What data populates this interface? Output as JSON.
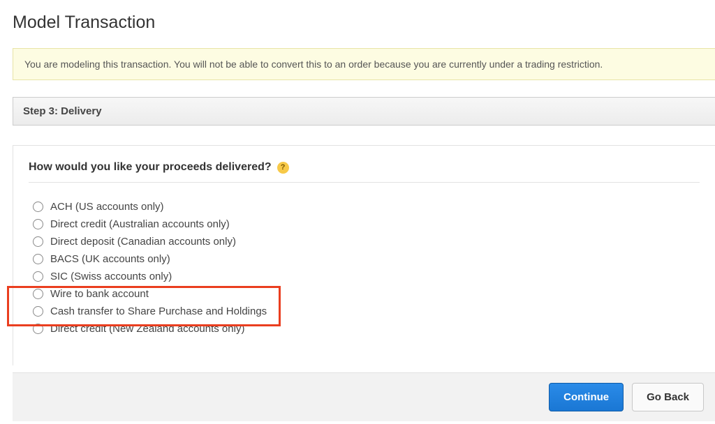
{
  "page": {
    "title": "Model Transaction"
  },
  "notice": {
    "text": "You are modeling this transaction. You will not be able to convert this to an order because you are currently under a trading restriction."
  },
  "step": {
    "label": "Step 3: Delivery"
  },
  "question": {
    "text": "How would you like your proceeds delivered?",
    "help": "?"
  },
  "options": [
    {
      "label": "ACH (US accounts only)"
    },
    {
      "label": "Direct credit (Australian accounts only)"
    },
    {
      "label": "Direct deposit (Canadian accounts only)"
    },
    {
      "label": "BACS (UK accounts only)"
    },
    {
      "label": "SIC (Swiss accounts only)"
    },
    {
      "label": "Wire to bank account"
    },
    {
      "label": "Cash transfer to Share Purchase and Holdings"
    },
    {
      "label": "Direct credit (New Zealand accounts only)"
    }
  ],
  "buttons": {
    "continue": "Continue",
    "back": "Go Back"
  }
}
